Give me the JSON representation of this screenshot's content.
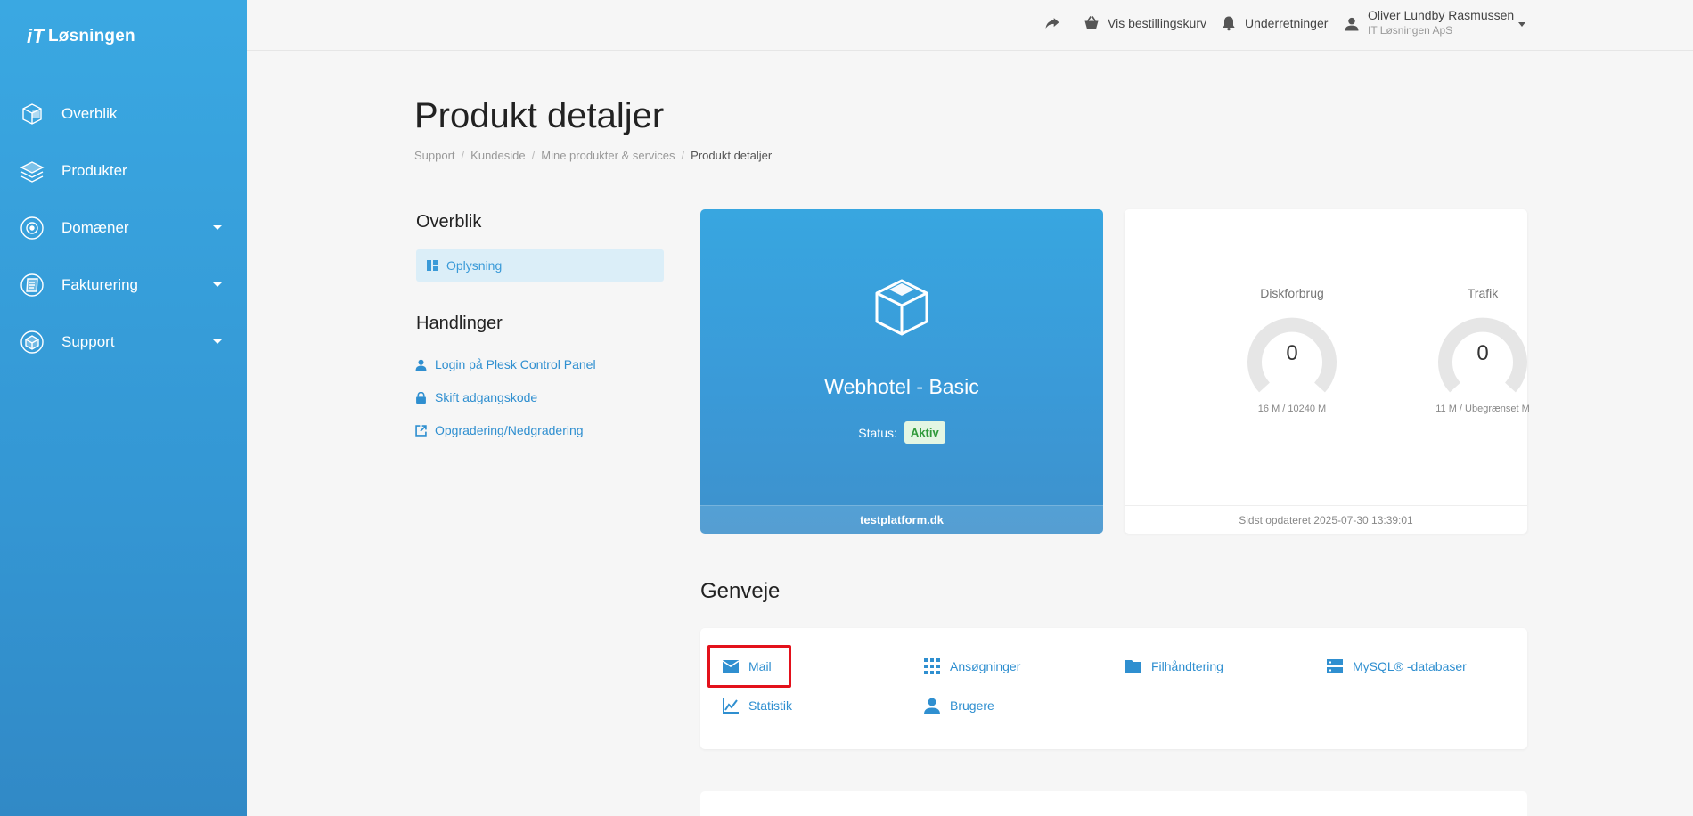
{
  "brand": {
    "name": "Løsningen",
    "mark": "iT"
  },
  "sidebar": {
    "items": [
      {
        "label": "Overblik",
        "icon": "overview-icon",
        "has_caret": false
      },
      {
        "label": "Produkter",
        "icon": "box-layers-icon",
        "has_caret": false
      },
      {
        "label": "Domæner",
        "icon": "globe-icon",
        "has_caret": true
      },
      {
        "label": "Fakturering",
        "icon": "invoice-icon",
        "has_caret": true
      },
      {
        "label": "Support",
        "icon": "support-box-icon",
        "has_caret": true
      }
    ]
  },
  "topbar": {
    "cart_label": "Vis bestillingskurv",
    "notifications_label": "Underretninger",
    "user_name": "Oliver Lundby Rasmussen",
    "user_company": "IT Løsningen ApS"
  },
  "page": {
    "title": "Produkt detaljer",
    "breadcrumb": [
      "Support",
      "Kundeside",
      "Mine produkter & services",
      "Produkt detaljer"
    ]
  },
  "left": {
    "overview_title": "Overblik",
    "overview_items": [
      "Oplysning"
    ],
    "actions_title": "Handlinger",
    "actions": [
      {
        "label": "Login på Plesk Control Panel",
        "icon": "user-icon"
      },
      {
        "label": "Skift adgangskode",
        "icon": "lock-icon"
      },
      {
        "label": "Opgradering/Nedgradering",
        "icon": "external-link-icon"
      }
    ]
  },
  "product": {
    "name": "Webhotel - Basic",
    "status_label": "Status:",
    "status_value": "Aktiv",
    "domain": "testplatform.dk"
  },
  "usage": {
    "disk": {
      "title": "Diskforbrug",
      "value": "0",
      "detail": "16 M / 10240 M"
    },
    "traffic": {
      "title": "Trafik",
      "value": "0",
      "detail": "11 M / Ubegrænset M"
    },
    "updated": "Sidst opdateret 2025-07-30 13:39:01"
  },
  "shortcuts": {
    "title": "Genveje",
    "items": [
      {
        "label": "Mail",
        "icon": "mail-icon"
      },
      {
        "label": "Ansøgninger",
        "icon": "apps-grid-icon"
      },
      {
        "label": "Filhåndtering",
        "icon": "folder-icon"
      },
      {
        "label": "MySQL® -databaser",
        "icon": "database-icon"
      },
      {
        "label": "Statistik",
        "icon": "chart-icon"
      },
      {
        "label": "Brugere",
        "icon": "person-icon"
      }
    ]
  },
  "colors": {
    "sidebar": "#3aa8e2",
    "link": "#2f8fd0",
    "status_green": "#2f9a3a",
    "highlight": "#e3111b"
  }
}
